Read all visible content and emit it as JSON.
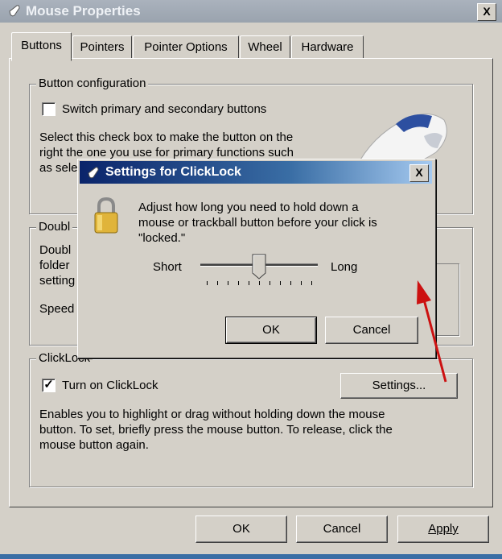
{
  "window": {
    "title": "Mouse Properties",
    "close_glyph": "X"
  },
  "tabs": [
    {
      "label": "Buttons",
      "active": true
    },
    {
      "label": "Pointers",
      "active": false
    },
    {
      "label": "Pointer Options",
      "active": false
    },
    {
      "label": "Wheel",
      "active": false
    },
    {
      "label": "Hardware",
      "active": false
    }
  ],
  "button_config": {
    "group_label": "Button configuration",
    "checkbox_label": "Switch primary and secondary buttons",
    "checked": false,
    "description_lines": [
      "Select this check box to make the button on the",
      "right the one you use for primary functions such",
      "as sele"
    ]
  },
  "double_click": {
    "group_label": "Doubl",
    "description_lines": [
      "Doubl",
      "folder",
      "setting"
    ],
    "speed_label": "Speed"
  },
  "clicklock": {
    "group_label": "ClickLock",
    "checkbox_label": "Turn on ClickLock",
    "checked": true,
    "settings_button": "Settings...",
    "description_lines": [
      "Enables you to highlight or drag without holding down the mouse",
      "button. To set, briefly press the mouse button. To release, click the",
      "mouse button again."
    ]
  },
  "footer": {
    "ok": "OK",
    "cancel": "Cancel",
    "apply": "Apply"
  },
  "dialog": {
    "title": "Settings for ClickLock",
    "close_glyph": "X",
    "message_lines": [
      "Adjust how long you need to hold down a",
      "mouse or trackball button before your click is",
      "\"locked.\""
    ],
    "slider": {
      "min_label": "Short",
      "max_label": "Long",
      "value_fraction": 0.5,
      "tick_count": 11
    },
    "ok": "OK",
    "cancel": "Cancel"
  },
  "colors": {
    "dialog_title": "#0a246a",
    "face": "#d4d0c8",
    "arrow": "#cc1111"
  },
  "icons": [
    "mouse-icon",
    "lock-icon",
    "mouse-illustration",
    "red-arrow"
  ]
}
